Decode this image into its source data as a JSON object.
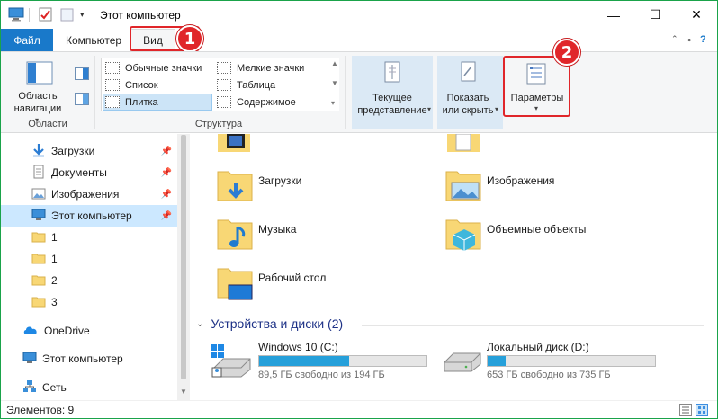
{
  "window": {
    "title": "Этот компьютер"
  },
  "title_buttons": {
    "minimize": "—",
    "maximize": "☐",
    "close": "✕"
  },
  "tabs": {
    "file": "Файл",
    "computer": "Компьютер",
    "view": "Вид"
  },
  "annotations": {
    "badge1": "1",
    "badge2": "2"
  },
  "ribbon": {
    "areas": {
      "nav_label_line1": "Область",
      "nav_label_line2": "навигации",
      "group": "Области"
    },
    "layout": {
      "group": "Структура",
      "items": [
        "Обычные значки",
        "Мелкие значки",
        "Список",
        "Таблица",
        "Плитка",
        "Содержимое"
      ],
      "selected": "Плитка"
    },
    "current_view": {
      "line1": "Текущее",
      "line2": "представление"
    },
    "show_hide": {
      "line1": "Показать",
      "line2": "или скрыть"
    },
    "options": {
      "label": "Параметры"
    }
  },
  "nav": {
    "items": [
      {
        "label": "Загрузки",
        "icon": "download-icon",
        "pinned": true
      },
      {
        "label": "Документы",
        "icon": "document-icon",
        "pinned": true
      },
      {
        "label": "Изображения",
        "icon": "pictures-icon",
        "pinned": true
      },
      {
        "label": "Этот компьютер",
        "icon": "computer-icon",
        "pinned": true,
        "selected": true
      },
      {
        "label": "1",
        "icon": "folder-icon"
      },
      {
        "label": "1",
        "icon": "folder-icon"
      },
      {
        "label": "2",
        "icon": "folder-icon"
      },
      {
        "label": "3",
        "icon": "folder-icon"
      },
      {
        "label": "OneDrive",
        "icon": "cloud-icon"
      },
      {
        "label": "Этот компьютер",
        "icon": "computer-icon"
      },
      {
        "label": "Сеть",
        "icon": "network-icon"
      }
    ]
  },
  "folders": {
    "downloads": "Загрузки",
    "pictures": "Изображения",
    "music": "Музыка",
    "objects3d": "Объемные объекты",
    "desktop": "Рабочий стол"
  },
  "devices": {
    "header": "Устройства и диски (2)",
    "drives": [
      {
        "name": "Windows 10 (C:)",
        "free": "89,5 ГБ свободно из 194 ГБ",
        "used_fraction": 0.54
      },
      {
        "name": "Локальный диск (D:)",
        "free": "653 ГБ свободно из 735 ГБ",
        "used_fraction": 0.11
      }
    ]
  },
  "status": {
    "items": "Элементов: 9"
  },
  "colors": {
    "accent": "#1979ca",
    "highlight": "#e0262a",
    "selection": "#cce8ff",
    "bar": "#26a0da"
  }
}
